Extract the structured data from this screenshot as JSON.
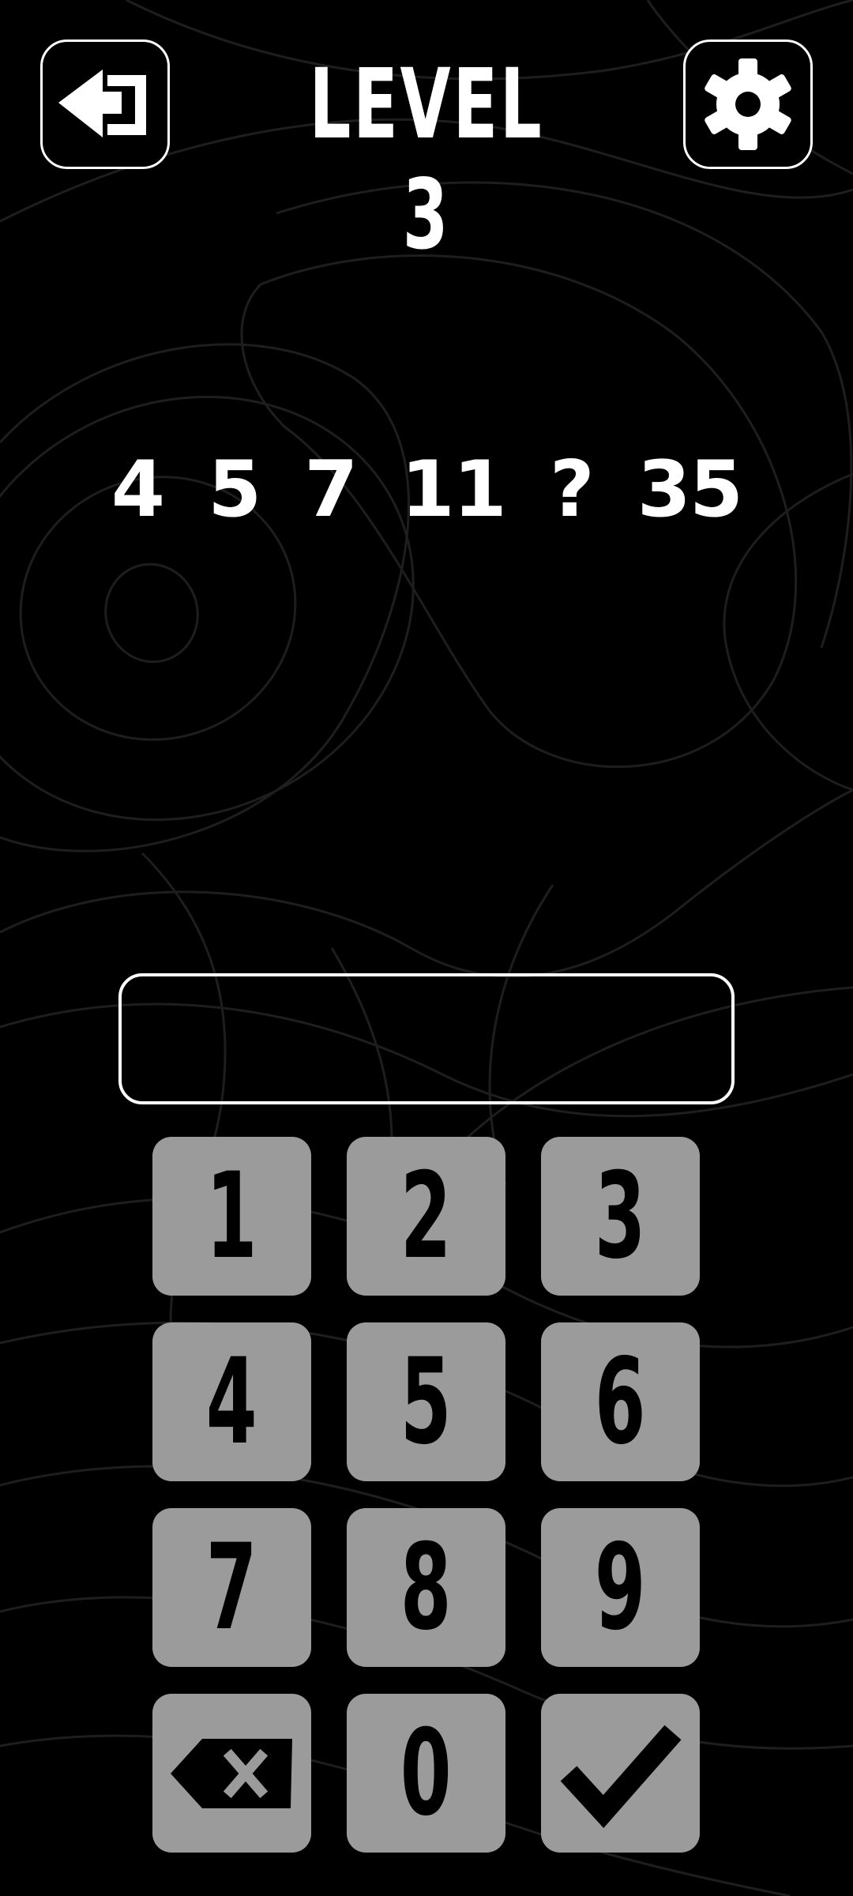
{
  "header": {
    "title": "LEVEL 3"
  },
  "puzzle": {
    "sequence": [
      "4",
      "5",
      "7",
      "11",
      "?",
      "35"
    ]
  },
  "answer": {
    "value": ""
  },
  "keypad": {
    "keys": [
      "1",
      "2",
      "3",
      "4",
      "5",
      "6",
      "7",
      "8",
      "9",
      "0"
    ]
  },
  "theme": {
    "background": "#000000",
    "foreground": "#ffffff",
    "key_fill": "#9b9b9b",
    "key_text": "#000000",
    "contour_lines": "#1e1e1e"
  },
  "icons": {
    "back": "exit-arrow-icon",
    "settings": "gear-icon",
    "delete": "backspace-icon",
    "confirm": "checkmark-icon"
  }
}
